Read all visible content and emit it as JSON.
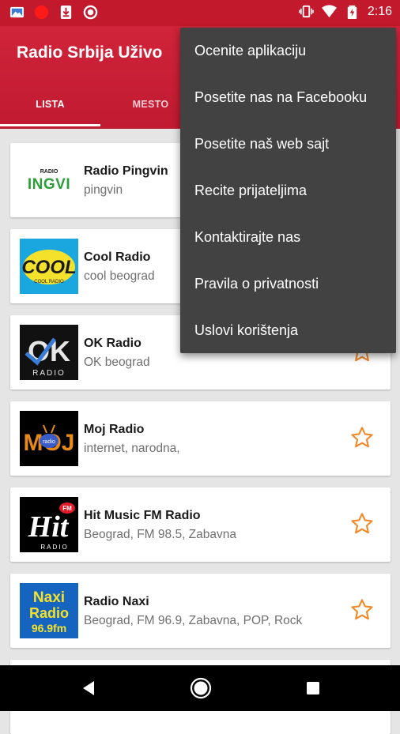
{
  "status_bar": {
    "time": "2:16",
    "left_icons": [
      "image-icon",
      "record-icon",
      "download-icon",
      "circle-icon"
    ],
    "right_icons": [
      "vibrate-icon",
      "wifi-icon",
      "battery-icon"
    ]
  },
  "app": {
    "title": "Radio Srbija Uživo",
    "tabs": [
      {
        "label": "LISTA",
        "active": true
      },
      {
        "label": "MESTO",
        "active": false
      }
    ]
  },
  "stations": [
    {
      "name": "Radio Pingvin",
      "desc": "pingvin",
      "logo": "pingvin-logo",
      "logo_text": "RADIO INGVI"
    },
    {
      "name": "Cool Radio",
      "desc": "cool beograd",
      "logo": "cool-radio-logo",
      "logo_text": "COOL COOL RADIO"
    },
    {
      "name": " OK Radio",
      "desc": "OK beograd",
      "logo": "ok-radio-logo",
      "logo_text": "OK RADIO"
    },
    {
      "name": "Moj Radio",
      "desc": "internet, narodna,",
      "logo": "moj-radio-logo",
      "logo_text": "MOJ radio"
    },
    {
      "name": "Hit Music FM Radio",
      "desc": "Beograd, FM 98.5, Zabavna",
      "logo": "hit-fm-logo",
      "logo_text": "Hit FM RADIO"
    },
    {
      "name": "Radio Naxi",
      "desc": "Beograd, FM 96.9, Zabavna, POP, Rock",
      "logo": "naxi-radio-logo",
      "logo_text": "Naxi Radio 96.9fm"
    }
  ],
  "menu": {
    "items": [
      "Ocenite aplikaciju",
      "Posetite nas na Facebooku",
      "Posetite naš web sajt",
      "Recite prijateljima",
      "Kontaktirajte nas",
      "Pravila o privatnosti",
      "Uslovi korištenja"
    ]
  },
  "colors": {
    "primary": "#c2192c",
    "star": "#f08a2b",
    "menu_bg": "#424242"
  }
}
